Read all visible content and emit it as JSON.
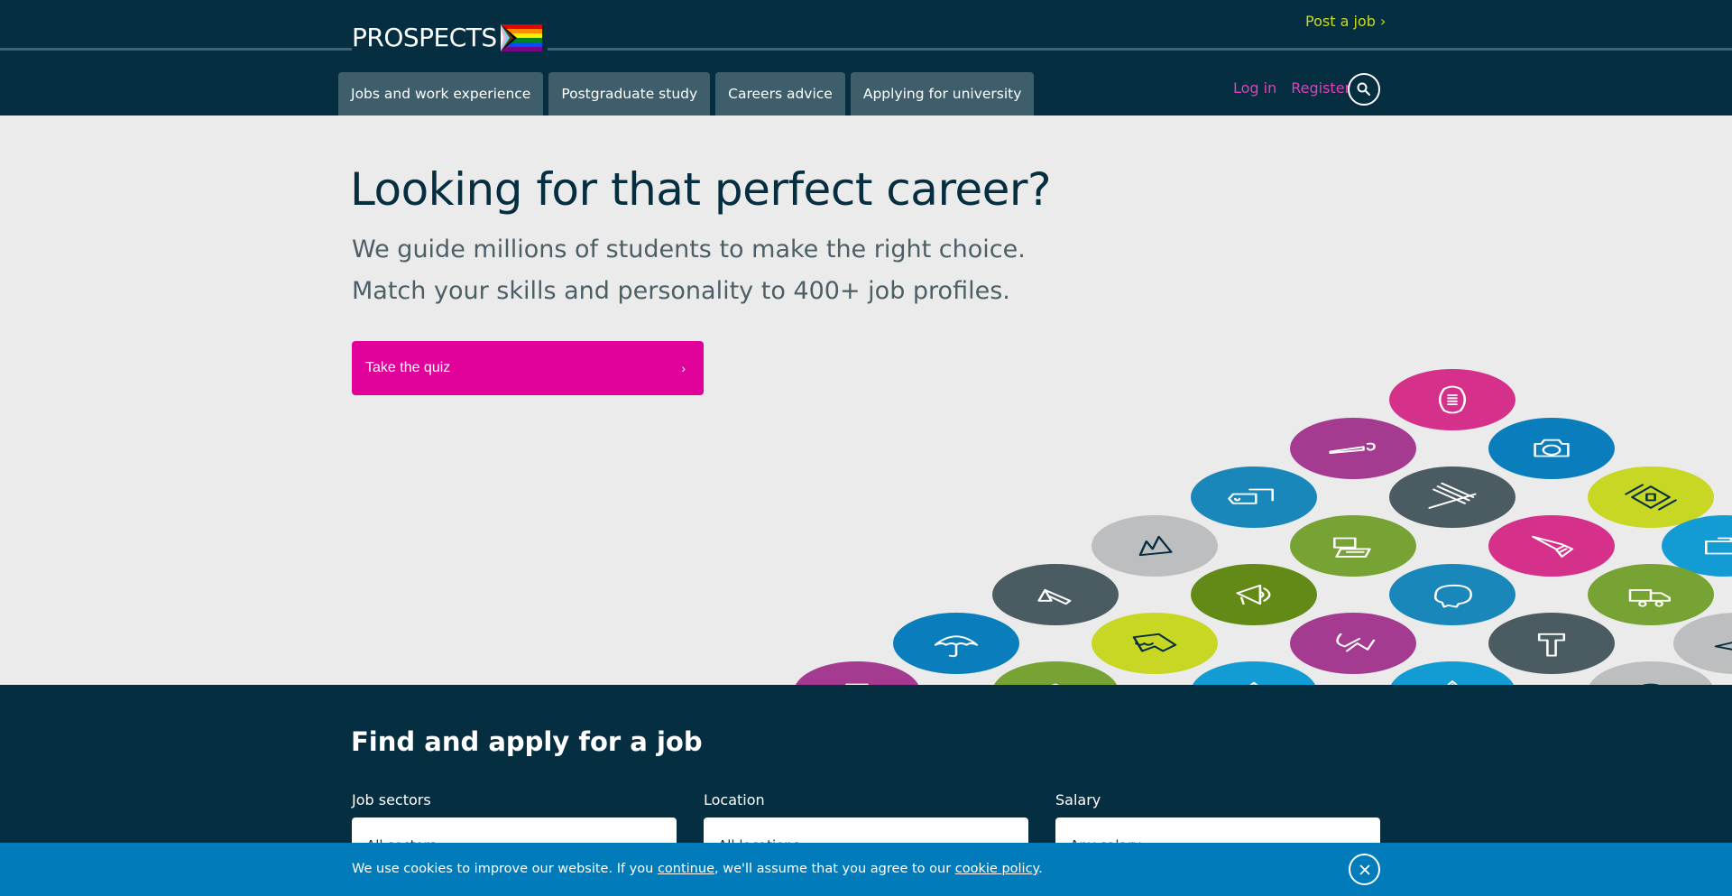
{
  "brand": {
    "name": "PROSPECTS",
    "flag_icon": "progress-pride-flag-icon",
    "colors": {
      "navy": "#062e41",
      "tab_bg": "#3e5e6b",
      "lime": "#c8dc1e",
      "magenta": "#e0009a",
      "pink_link": "#e040b8",
      "cookie_blue": "#017bba",
      "hero_bg": "#ebebeb"
    }
  },
  "header": {
    "post_job": "Post a job ›",
    "nav_tabs": [
      {
        "label": "Jobs and work experience"
      },
      {
        "label": "Postgraduate study"
      },
      {
        "label": "Careers advice"
      },
      {
        "label": "Applying for university"
      }
    ],
    "login": "Log in",
    "register": "Register",
    "search_icon": "search-icon"
  },
  "hero": {
    "title": "Looking for that perfect career?",
    "subtitle_line1": "We guide millions of students to make the right choice.",
    "subtitle_line2": "Match your skills and personality to 400+ job profiles.",
    "cta_label": "Take the quiz",
    "cta_icon": "›",
    "circle_icons": [
      {
        "icon": "rugby-ball-icon",
        "color": "#d6318a",
        "ink": "#ffffff"
      },
      {
        "icon": "paintbrush-icon",
        "color": "#a53a91",
        "ink": "#ffffff"
      },
      {
        "icon": "camera-icon",
        "color": "#0a7ebc",
        "ink": "#ffffff"
      },
      {
        "icon": "price-tags-icon",
        "color": "#1a87bb",
        "ink": "#ffffff"
      },
      {
        "icon": "books-icon",
        "color": "#4a5c62",
        "ink": "#ffffff"
      },
      {
        "icon": "medical-kit-icon",
        "color": "#c8d624",
        "ink": "#062e41"
      },
      {
        "icon": "mountain-icon",
        "color": "#bcbec0",
        "ink": "#062e41"
      },
      {
        "icon": "laptop-icon",
        "color": "#76a333",
        "ink": "#ffffff"
      },
      {
        "icon": "flask-icon",
        "color": "#d6318a",
        "ink": "#ffffff"
      },
      {
        "icon": "briefcase-icon",
        "color": "#139bd4",
        "ink": "#ffffff"
      },
      {
        "icon": "desk-lamp-icon",
        "color": "#4a5c62",
        "ink": "#ffffff"
      },
      {
        "icon": "megaphone-icon",
        "color": "#638a16",
        "ink": "#ffffff"
      },
      {
        "icon": "piggy-bank-icon",
        "color": "#1a87bb",
        "ink": "#ffffff"
      },
      {
        "icon": "truck-icon",
        "color": "#76a333",
        "ink": "#ffffff"
      },
      {
        "icon": "umbrella-icon",
        "color": "#0a7ebc",
        "ink": "#ffffff"
      },
      {
        "icon": "shirt-icon",
        "color": "#c8d624",
        "ink": "#062e41"
      },
      {
        "icon": "dentist-chair-icon",
        "color": "#a53a91",
        "ink": "#ffffff"
      },
      {
        "icon": "gavel-icon",
        "color": "#4a5c62",
        "ink": "#ffffff"
      },
      {
        "icon": "paper-plane-icon",
        "color": "#bcbec0",
        "ink": "#062e41"
      },
      {
        "icon": "wine-glass-icon",
        "color": "#a53a91",
        "ink": "#ffffff"
      },
      {
        "icon": "graduation-icon",
        "color": "#76a333",
        "ink": "#ffffff"
      },
      {
        "icon": "house-icon",
        "color": "#139bd4",
        "ink": "#ffffff"
      },
      {
        "icon": "leaf-icon",
        "color": "#139bd4",
        "ink": "#ffffff"
      },
      {
        "icon": "globe-icon",
        "color": "#bcbec0",
        "ink": "#062e41"
      }
    ]
  },
  "job_search": {
    "title": "Find and apply for a job",
    "fields": [
      {
        "label": "Job sectors",
        "value": "All sectors"
      },
      {
        "label": "Location",
        "value": "All locations"
      },
      {
        "label": "Salary",
        "value": "Any salary"
      }
    ]
  },
  "cookie_bar": {
    "text_before": "We use cookies to improve our website. If you ",
    "link_continue": "continue",
    "text_middle": ", we'll assume that you agree to our ",
    "link_policy": "cookie policy",
    "text_after": ".",
    "close_icon": "close-icon"
  }
}
